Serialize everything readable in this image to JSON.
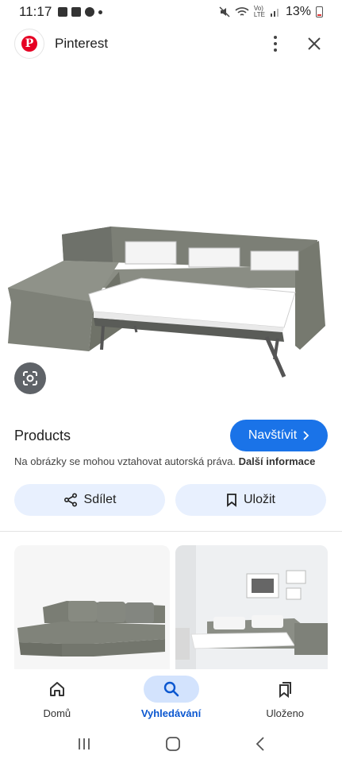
{
  "status_bar": {
    "time": "11:17",
    "battery": "13%"
  },
  "header": {
    "app_name": "Pinterest",
    "logo_letter": "P"
  },
  "product": {
    "title": "Products",
    "visit_label": "Navštívit",
    "copyright_text": "Na obrázky se mohou vztahovat autorská práva.",
    "copyright_link": "Další informace"
  },
  "actions": {
    "share_label": "Sdílet",
    "save_label": "Uložit"
  },
  "bottom_nav": {
    "items": [
      {
        "label": "Domů",
        "icon": "home-icon",
        "active": false
      },
      {
        "label": "Vyhledávání",
        "icon": "search-icon",
        "active": true
      },
      {
        "label": "Uloženo",
        "icon": "saved-icon",
        "active": false
      }
    ]
  },
  "colors": {
    "accent": "#1a73e8",
    "active_nav": "#d3e3fd",
    "pinterest": "#e60023",
    "tonal_button": "#e8f0fe"
  }
}
